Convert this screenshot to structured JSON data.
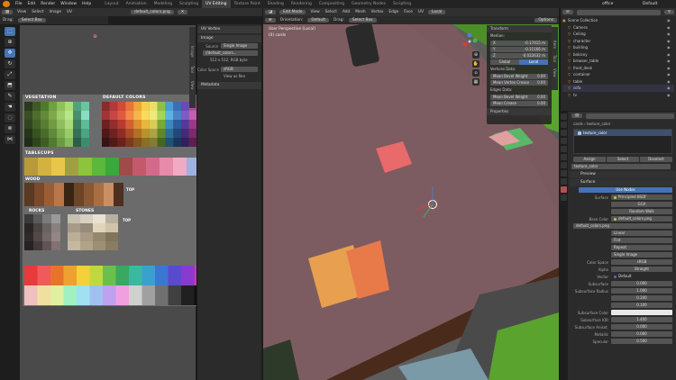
{
  "topbar": {
    "menus": [
      "File",
      "Edit",
      "Render",
      "Window",
      "Help"
    ],
    "workspaces": [
      "Layout",
      "Animation",
      "Modeling",
      "Sculpting",
      "UV Editing",
      "Texture Paint",
      "Shading",
      "Rendering",
      "Compositing",
      "Geometry Nodes",
      "Scripting"
    ],
    "active_workspace": "UV Editing",
    "scene": "office",
    "view_layer": "Default"
  },
  "uv_header": {
    "items": [
      "View",
      "Select",
      "Image",
      "UV"
    ],
    "image_name": "default_colors.png",
    "drag_label": "Drag:",
    "select_box": "Select Box"
  },
  "uv_sidebar": {
    "tab_label": "UV Vertex",
    "image_panel": "Image",
    "source_label": "Source",
    "source_value": "Single Image",
    "filepath": "//default_colors...",
    "resolution": "512 x 512,  RGB byte",
    "colorspace_label": "Color Space",
    "colorspace_value": "sRGB",
    "view_as_render": "View as Ren",
    "metadata_panel": "Metadata",
    "tabs": [
      "Image",
      "Tool",
      "View"
    ]
  },
  "palette": {
    "labels": {
      "vegetation": "VEGETATION",
      "default_colors": "DEFAULT COLORS",
      "tablecups": "TABLECUPS",
      "wood": "WOOD",
      "rocks": "ROCKS",
      "stones": "STONES",
      "top1": "TOP",
      "top2": "TOP",
      "top3": "TOP"
    },
    "vegetation_colors": [
      "#2b3a1e",
      "#3f5a26",
      "#4e7a2e",
      "#6fa042",
      "#8dc25a",
      "#a8dc74",
      "#53a17a",
      "#6bc4a1",
      "#3a4d25",
      "#506d2e",
      "#65893a",
      "#7fa84b",
      "#9ccd6a",
      "#b7e68a",
      "#49906a",
      "#8bdcc4",
      "#2f4521",
      "#44612a",
      "#597c33",
      "#729a45",
      "#90bd5d",
      "#abd97c",
      "#3f7f5e",
      "#5dbb98",
      "#243619",
      "#385322",
      "#4b6c2b",
      "#618a3a",
      "#7dac50",
      "#98cc6a",
      "#367155",
      "#4aa583",
      "#1f2d16",
      "#2f461d",
      "#3f5d25",
      "#527a30",
      "#6b9a43",
      "#86ba5c",
      "#2d5f48",
      "#3c8d6d"
    ],
    "default_colors_colors": [
      "#8b2a2a",
      "#b33838",
      "#d14a3a",
      "#e8743a",
      "#f0a53a",
      "#f5cf4a",
      "#e8e06a",
      "#8fbf46",
      "#4a9fd1",
      "#3a6fb3",
      "#6a4ab3",
      "#b34a9f",
      "#e86aa0",
      "#e8a0c0",
      "#d0d0d0",
      "#7a7a7a",
      "#a33434",
      "#c84545",
      "#e2593f",
      "#f28945",
      "#f5b648",
      "#f8dc5a",
      "#eeea7c",
      "#a6d35a",
      "#5cb3e2",
      "#4c82c6",
      "#7c5cc6",
      "#c65cb3",
      "#f07cb3",
      "#f0b4d0",
      "#e0e0e0",
      "#8a8a8a",
      "#6d2020",
      "#952d2d",
      "#b83a30",
      "#d4622f",
      "#dd8f2f",
      "#e6b83a",
      "#d8cc55",
      "#78a837",
      "#3a8abd",
      "#2d5b9c",
      "#56389c",
      "#9c3888",
      "#d05588",
      "#d08aa8",
      "#b8b8b8",
      "#5e5e5e",
      "#501818",
      "#702222",
      "#8f2d25",
      "#a84c25",
      "#b07025",
      "#b8922d",
      "#aca445",
      "#5f872b",
      "#2d6e98",
      "#22477a",
      "#432b7a",
      "#7a2b6b",
      "#a3436b",
      "#a36e85",
      "#959595",
      "#464646",
      "#3a1212",
      "#521919",
      "#6b221c",
      "#7d391c",
      "#84541c",
      "#8a6e22",
      "#827b34",
      "#466620",
      "#225272",
      "#1a355c",
      "#32205c",
      "#5c2050",
      "#7a3250",
      "#7a5264",
      "#737373",
      "#303030"
    ],
    "tablecups_colors": [
      "#b89a3a",
      "#d4b240",
      "#e8c64a",
      "#a0a042",
      "#8cc43a",
      "#5cb83a",
      "#3aa83a",
      "#a04a4a",
      "#c25a6a",
      "#d46a8a",
      "#e88aaa",
      "#f0aac4",
      "#a0b0e0",
      "#c0c8f0"
    ],
    "wood_colors": [
      "#5a3a22",
      "#7a4a2a",
      "#9a5e36",
      "#b8764a",
      "#3a2414",
      "#6b4526",
      "#8a5832",
      "#a86e44",
      "#c98e64",
      "#4d3020"
    ],
    "rocks_colors": [
      "#3a3a3a",
      "#5a5a5a",
      "#7a7a7a",
      "#9a9a9a",
      "#2a2626",
      "#4a4444",
      "#6a6262",
      "#8a8080",
      "#302a2a",
      "#524848",
      "#726666",
      "#948686",
      "#262222",
      "#423a3a",
      "#605454",
      "#807272"
    ],
    "stones_colors": [
      "#c8c0b0",
      "#d8d0c0",
      "#e8e0d0",
      "#b8b0a0",
      "#a89a88",
      "#968a7a",
      "#e0d4bc",
      "#d0c4aa",
      "#bcae96",
      "#a89a84",
      "#94886e",
      "#80745e",
      "#c4b8a0",
      "#b0a488",
      "#9c9074",
      "#887c62"
    ],
    "rainbow_colors": [
      "#e83a3a",
      "#f05a5a",
      "#e8742a",
      "#f0a030",
      "#f5d03a",
      "#c0d840",
      "#6ac04a",
      "#3aa860",
      "#3ab8a0",
      "#3aa0d0",
      "#3a78d0",
      "#5a4ad0",
      "#8a3ad0",
      "#c03ab0",
      "#e04a8a",
      "#f06aa0",
      "#f0c0c0",
      "#f0e0a0",
      "#e0f0a0",
      "#a0f0c0",
      "#a0e0f0",
      "#a0c0f0",
      "#c0a0f0",
      "#f0a0e0",
      "#d0d0d0",
      "#a0a0a0",
      "#707070",
      "#404040",
      "#202020",
      "#101010",
      "#ff3aa0",
      "#ffd0e8"
    ]
  },
  "viewport_header": {
    "mode": "Edit Mode",
    "items": [
      "View",
      "Select",
      "Add",
      "Mesh",
      "Vertex",
      "Edge",
      "Face",
      "UV"
    ],
    "orientation_label": "Orientation:",
    "orientation_value": "Default",
    "drag_label": "Drag:",
    "select_box": "Select Box",
    "transform_space": "Local",
    "options": "Options"
  },
  "viewport": {
    "view_name": "User Perspective (Local)",
    "object_name": "(0) cards",
    "right_tabs": [
      "Item",
      "Tool",
      "View"
    ]
  },
  "n_panel": {
    "title": "Transform",
    "median_label": "Median:",
    "x_label": "X",
    "x_value": "-0.17415 m",
    "y_label": "Y",
    "y_value": "-0.11166 m",
    "z_label": "Z",
    "z_value": "-0.022632 m",
    "global_btn": "Global",
    "local_btn": "Local",
    "vertices_data": "Vertices Data:",
    "mean_bevel_weight": "Mean Bevel Weight",
    "mean_bevel_value": "0.00",
    "mean_vertex_crease": "Mean Vertex Crease",
    "mean_vertex_value": "0.00",
    "edges_data": "Edges Data:",
    "edge_bevel_weight": "Mean Bevel Weight",
    "edge_bevel_value": "0.00",
    "mean_crease": "Mean Crease",
    "mean_crease_value": "0.00",
    "properties": "Properties"
  },
  "outliner": {
    "header_search": "",
    "title": "Scene Collection",
    "items": [
      {
        "name": "Scene Collection",
        "indent": 0
      },
      {
        "name": "Camera",
        "indent": 1
      },
      {
        "name": "Ceiling",
        "indent": 1
      },
      {
        "name": "character",
        "indent": 1
      },
      {
        "name": "building",
        "indent": 1
      },
      {
        "name": "balcony",
        "indent": 1
      },
      {
        "name": "browser_table",
        "indent": 1
      },
      {
        "name": "front_desk",
        "indent": 1
      },
      {
        "name": "container",
        "indent": 1
      },
      {
        "name": "table",
        "indent": 1
      },
      {
        "name": "sofa",
        "indent": 1
      },
      {
        "name": "tv",
        "indent": 1
      }
    ]
  },
  "properties": {
    "breadcrumb_object": "cards",
    "breadcrumb_mat": "texture_color",
    "slot_name": "texture_color",
    "mat_name": "texture_color",
    "tabs": [
      "Preview",
      "Surface"
    ],
    "use_nodes": "Use Nodes",
    "surface_label": "Surface",
    "surface_value": "Principled BSDF",
    "dist1": "GGX",
    "dist2": "Random Walk",
    "base_color_label": "Base Color",
    "base_color_value": "default_colors.png",
    "image_name": "default_colors.png",
    "interp": "Linear",
    "proj": "Flat",
    "ext": "Repeat",
    "source": "Single Image",
    "colorspace_label": "Color Space",
    "colorspace_value": "sRGB",
    "alpha_label": "Alpha",
    "alpha_value": "Straight",
    "vector_label": "Vector",
    "vector_value": "Default",
    "subsurface_label": "Subsurface",
    "subsurface_value": "0.000",
    "radius_label": "Subsurface Radius",
    "radius_values": [
      "1.000",
      "0.200",
      "0.100"
    ],
    "ss_color_label": "Subsurface Color",
    "ss_ior_label": "Subsurface IOR",
    "ss_ior_value": "1.400",
    "ss_aniso_label": "Subsurface Anisot.",
    "ss_aniso_value": "0.000",
    "metallic_label": "Metallic",
    "metallic_value": "0.000",
    "specular_label": "Specular",
    "specular_value": "0.500",
    "slots": [
      "Assign",
      "Select",
      "Deselect"
    ]
  }
}
